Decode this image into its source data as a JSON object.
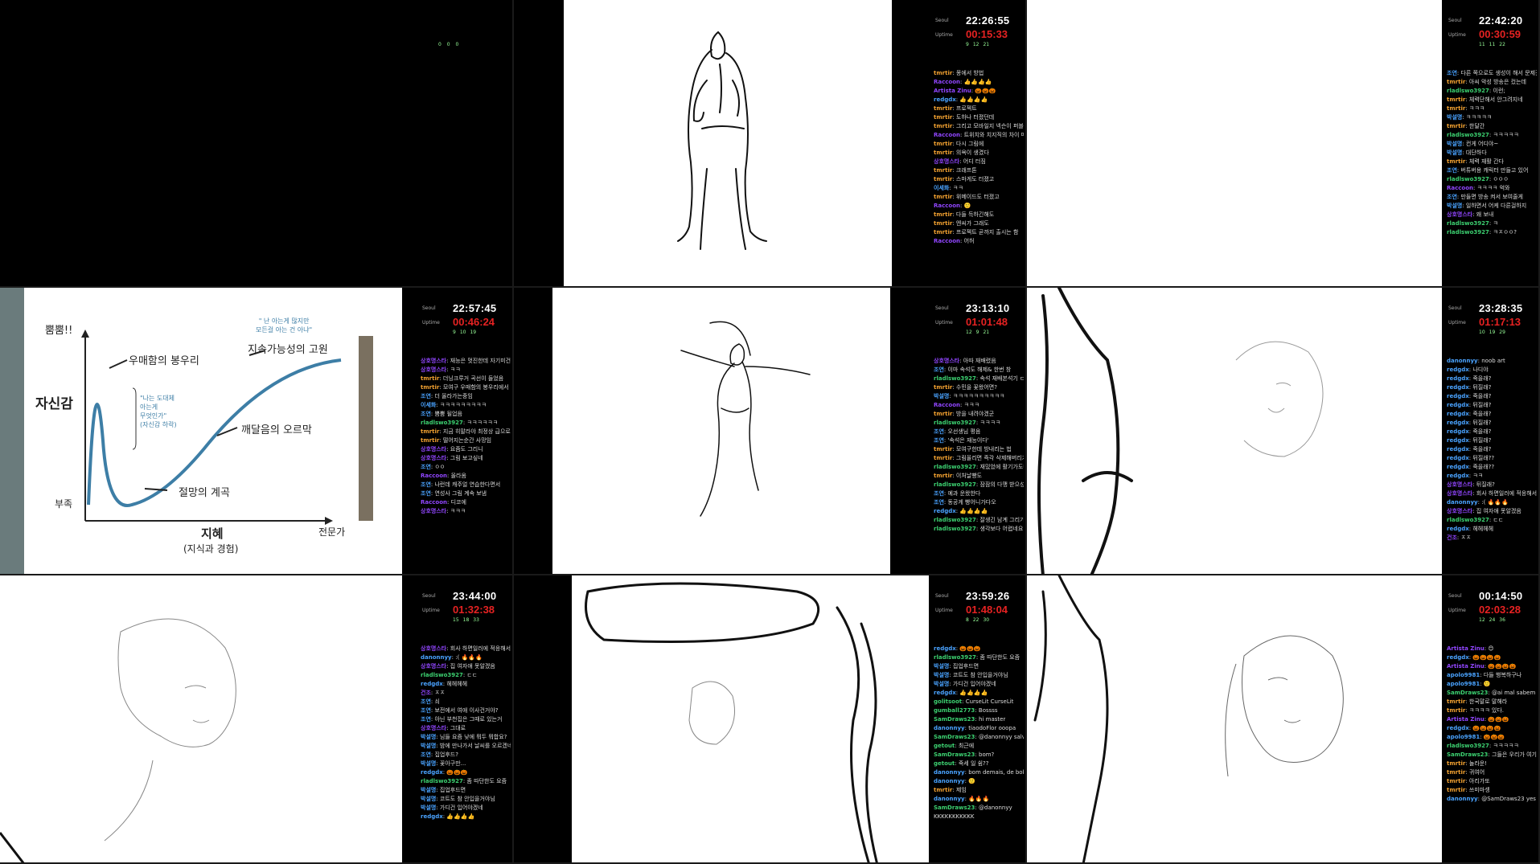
{
  "cells": [
    {
      "stats": {
        "a": "0",
        "b": "0",
        "c": "0"
      }
    },
    {
      "clock_label": "Seoul",
      "uptime_label": "Uptime",
      "time": "22:26:55",
      "uptime": "00:15:33",
      "stats": {
        "a": "9",
        "b": "12",
        "c": "21"
      },
      "chat": [
        {
          "user": "tmrtir",
          "color": "#f0a030",
          "text": "몽에서 방법"
        },
        {
          "user": "Raccoon",
          "color": "#9146ff",
          "text": "👍👍👍👍"
        },
        {
          "user": "Artista Zinu",
          "color": "#9146ff",
          "text": "🎃🎃🎃"
        },
        {
          "user": "redgdx",
          "color": "#4aa3ff",
          "text": "👍👍👍👍"
        },
        {
          "user": "tmrtir",
          "color": "#f0a030",
          "text": "프로젝트"
        },
        {
          "user": "tmrtir",
          "color": "#f0a030",
          "text": "도하나 터졌던데"
        },
        {
          "user": "tmrtir",
          "color": "#f0a030",
          "text": "그리고 모바일지 넥슨이 퍼블리싱한다매"
        },
        {
          "user": "Raccoon",
          "color": "#9146ff",
          "text": "트위치와 치지직의 차이 매출"
        },
        {
          "user": "tmrtir",
          "color": "#f0a030",
          "text": "다시 그림에"
        },
        {
          "user": "tmrtir",
          "color": "#f0a030",
          "text": "의욕이 생겼다"
        },
        {
          "user": "상호명스타",
          "color": "#9146ff",
          "text": "어디 터짐"
        },
        {
          "user": "tmrtir",
          "color": "#f0a030",
          "text": "크래프톤"
        },
        {
          "user": "tmrtir",
          "color": "#f0a030",
          "text": "스마게도 터졌고"
        },
        {
          "user": "이세화",
          "color": "#4aa3ff",
          "text": "ㅋㅋ"
        },
        {
          "user": "tmrtir",
          "color": "#f0a030",
          "text": "위메이드도 터졌고"
        },
        {
          "user": "Raccoon",
          "color": "#9146ff",
          "text": "🙂"
        },
        {
          "user": "tmrtir",
          "color": "#f0a030",
          "text": "다들 득하긴해도"
        },
        {
          "user": "tmrtir",
          "color": "#f0a030",
          "text": "엔씨가 그래도"
        },
        {
          "user": "tmrtir",
          "color": "#f0a030",
          "text": "프로젝트 곧까지 출시는 함"
        },
        {
          "user": "Raccoon",
          "color": "#9146ff",
          "text": "어허"
        }
      ]
    },
    {
      "clock_label": "Seoul",
      "uptime_label": "Uptime",
      "time": "22:42:20",
      "uptime": "00:30:59",
      "stats": {
        "a": "11",
        "b": "11",
        "c": "22"
      },
      "chat": [
        {
          "user": "조연",
          "color": "#4aa3ff",
          "text": "다른 쪽으로도 생성이 해서 문제겠음"
        },
        {
          "user": "tmrtir",
          "color": "#f0a030",
          "text": "아씨 악성 방송은 컸는데"
        },
        {
          "user": "rladlswo3927",
          "color": "#3cd070",
          "text": "이런;"
        },
        {
          "user": "tmrtir",
          "color": "#f0a030",
          "text": "체력단해서 안그려지네"
        },
        {
          "user": "tmrtir",
          "color": "#f0a030",
          "text": "ㅋㅋㅋ"
        },
        {
          "user": "박설명",
          "color": "#4aa3ff",
          "text": "ㅋㅋㅋㅋㅋ"
        },
        {
          "user": "tmrtir",
          "color": "#f0a030",
          "text": "한달간"
        },
        {
          "user": "rladlswo3927",
          "color": "#3cd070",
          "text": "ㅋㅋㅋㅋㅋ"
        },
        {
          "user": "박설명",
          "color": "#4aa3ff",
          "text": "컨게 어디야~"
        },
        {
          "user": "박설명",
          "color": "#4aa3ff",
          "text": "대단하다"
        },
        {
          "user": "tmrtir",
          "color": "#f0a030",
          "text": "체력 재활 간다"
        },
        {
          "user": "조연",
          "color": "#4aa3ff",
          "text": "버튜버용 캐릭터 만들고 있어"
        },
        {
          "user": "rladlswo3927",
          "color": "#3cd070",
          "text": "ㅇㅇㅇ"
        },
        {
          "user": "Raccoon",
          "color": "#9146ff",
          "text": "ㅋㅋㅋㅋ 억와"
        },
        {
          "user": "조연",
          "color": "#4aa3ff",
          "text": "만들면 방송 켜서 보여줄게"
        },
        {
          "user": "박설명",
          "color": "#4aa3ff",
          "text": "일하면서 어케 다른걸하지"
        },
        {
          "user": "상호명스타",
          "color": "#9146ff",
          "text": "왜 보내"
        },
        {
          "user": "rladlswo3927",
          "color": "#3cd070",
          "text": "ㅋ"
        },
        {
          "user": "rladlswo3927",
          "color": "#3cd070",
          "text": "ㅋㅈㅇㅇ?"
        }
      ]
    },
    {
      "clock_label": "Seoul",
      "uptime_label": "Uptime",
      "time": "22:57:45",
      "uptime": "00:46:24",
      "stats": {
        "a": "9",
        "b": "10",
        "c": "19"
      },
      "slide": {
        "ylabel_top": "뿜뿜!!",
        "ylabel": "자신감",
        "ylabel_bottom": "부족",
        "xlabel": "지혜",
        "xlabel_sub": "(지식과 경험)",
        "xlabel_right": "전문가",
        "peak": "우매함의 봉우리",
        "valley": "절망의 계곡",
        "slope": "깨달음의 오르막",
        "plateau": "지속가능성의 고원",
        "quote_top": "\" 난 아는게 많지만\n모든걸 아는 건 아냐\"",
        "quote_mid": "\"나는 도대체\n아는게\n무엇인가\"\n(자신감 하락)"
      },
      "chat": [
        {
          "user": "상호명스타",
          "color": "#9146ff",
          "text": "재능은 멋진한데 자기미건 주입하려고 안될니서 문제임"
        },
        {
          "user": "상호명스타",
          "color": "#9146ff",
          "text": "ㅋㅋ"
        },
        {
          "user": "tmrtir",
          "color": "#f0a030",
          "text": "더닝크루거 곡선이 들었음"
        },
        {
          "user": "tmrtir",
          "color": "#f0a030",
          "text": "모여구 우매함의 봉우리에서 안내려옴"
        },
        {
          "user": "조연",
          "color": "#4aa3ff",
          "text": "더 올라가는중임"
        },
        {
          "user": "이세화",
          "color": "#4aa3ff",
          "text": "ㅋㅋㅋㅋㅋㅋㅋㅋㅋ"
        },
        {
          "user": "조연",
          "color": "#4aa3ff",
          "text": "뿜뿜 될업음"
        },
        {
          "user": "rladlswo3927",
          "color": "#3cd070",
          "text": "ㅋㅋㅋㅋㅋㅋ"
        },
        {
          "user": "tmrtir",
          "color": "#f0a030",
          "text": "지금 히말라야 최정상 급으로 높아서"
        },
        {
          "user": "tmrtir",
          "color": "#f0a030",
          "text": "떨어지는순간 사망임"
        },
        {
          "user": "상호명스타",
          "color": "#9146ff",
          "text": "요즘도 그리니"
        },
        {
          "user": "상호명스타",
          "color": "#9146ff",
          "text": "그림 보고싶네"
        },
        {
          "user": "조연",
          "color": "#4aa3ff",
          "text": "ㅇㅇ"
        },
        {
          "user": "Raccoon",
          "color": "#9146ff",
          "text": "올라옴"
        },
        {
          "user": "조연",
          "color": "#4aa3ff",
          "text": "나런데 캐주얼 연습한다면서"
        },
        {
          "user": "조연",
          "color": "#4aa3ff",
          "text": "연성사 그림 계속 보냄"
        },
        {
          "user": "Raccoon",
          "color": "#9146ff",
          "text": "디코에"
        },
        {
          "user": "상호명스타",
          "color": "#9146ff",
          "text": "ㅋㅋㅋ"
        }
      ]
    },
    {
      "clock_label": "Seoul",
      "uptime_label": "Uptime",
      "time": "23:13:10",
      "uptime": "01:01:48",
      "stats": {
        "a": "12",
        "b": "9",
        "c": "21"
      },
      "chat": [
        {
          "user": "상호명스타",
          "color": "#9146ff",
          "text": "아따 재배렸음"
        },
        {
          "user": "조연",
          "color": "#4aa3ff",
          "text": "이마 속석도 해제& 한번 창"
        },
        {
          "user": "rladlswo3927",
          "color": "#3cd070",
          "text": "속석 재배본석기 ㄷㄷ"
        },
        {
          "user": "tmrtir",
          "color": "#f0a030",
          "text": "수민을 꽃왔어면?"
        },
        {
          "user": "박설명",
          "color": "#4aa3ff",
          "text": "ㅋㅋㅋㅋㅋㅋㅋㅋㅋㅋ"
        },
        {
          "user": "Raccoon",
          "color": "#9146ff",
          "text": "ㅋㅋㅋ"
        },
        {
          "user": "tmrtir",
          "color": "#f0a030",
          "text": "방을 내려야겠군"
        },
        {
          "user": "rladlswo3927",
          "color": "#3cd070",
          "text": "ㅋㅋㅋㅋ"
        },
        {
          "user": "조연",
          "color": "#4aa3ff",
          "text": "오선생님 평음"
        },
        {
          "user": "조연",
          "color": "#4aa3ff",
          "text": "'속석은 재능이다'"
        },
        {
          "user": "tmrtir",
          "color": "#f0a030",
          "text": "모여구한데 방내리는 법"
        },
        {
          "user": "tmrtir",
          "color": "#f0a030",
          "text": "그림올리면 즉각 삭제해버리기"
        },
        {
          "user": "rladlswo3927",
          "color": "#3cd070",
          "text": "재밌었에 활기가도네"
        },
        {
          "user": "tmrtir",
          "color": "#f0a030",
          "text": "이처날빵도"
        },
        {
          "user": "rladlswo3927",
          "color": "#3cd070",
          "text": "잠잠의 다맹 받으성돈"
        },
        {
          "user": "조연",
          "color": "#4aa3ff",
          "text": "예과 운왔한다"
        },
        {
          "user": "조연",
          "color": "#4aa3ff",
          "text": "동공게 빵어니가다오"
        },
        {
          "user": "redgdx",
          "color": "#4aa3ff",
          "text": "👍👍👍👍"
        },
        {
          "user": "rladlswo3927",
          "color": "#3cd070",
          "text": "잘생긴 남계 그리기가"
        },
        {
          "user": "rladlswo3927",
          "color": "#3cd070",
          "text": "생각보다 어렵네요"
        }
      ]
    },
    {
      "clock_label": "Seoul",
      "uptime_label": "Uptime",
      "time": "23:28:35",
      "uptime": "01:17:13",
      "stats": {
        "a": "10",
        "b": "19",
        "c": "29"
      },
      "chat": [
        {
          "user": "danonnyy",
          "color": "#4aa3ff",
          "text": "noob art"
        },
        {
          "user": "redgdx",
          "color": "#4aa3ff",
          "text": "나디야"
        },
        {
          "user": "redgdx",
          "color": "#4aa3ff",
          "text": "죽을래?"
        },
        {
          "user": "redgdx",
          "color": "#4aa3ff",
          "text": "뒤질래?"
        },
        {
          "user": "redgdx",
          "color": "#4aa3ff",
          "text": "죽을래?"
        },
        {
          "user": "redgdx",
          "color": "#4aa3ff",
          "text": "뒤질래?"
        },
        {
          "user": "redgdx",
          "color": "#4aa3ff",
          "text": "죽을래?"
        },
        {
          "user": "redgdx",
          "color": "#4aa3ff",
          "text": "뒤질래?"
        },
        {
          "user": "redgdx",
          "color": "#4aa3ff",
          "text": "죽을래?"
        },
        {
          "user": "redgdx",
          "color": "#4aa3ff",
          "text": "뒤질래?"
        },
        {
          "user": "redgdx",
          "color": "#4aa3ff",
          "text": "죽을래?"
        },
        {
          "user": "redgdx",
          "color": "#4aa3ff",
          "text": "뒤질래??"
        },
        {
          "user": "redgdx",
          "color": "#4aa3ff",
          "text": "죽을래??"
        },
        {
          "user": "redgdx",
          "color": "#4aa3ff",
          "text": "ㅋㅋ"
        },
        {
          "user": "상호명스타",
          "color": "#9146ff",
          "text": "뒤질래?"
        },
        {
          "user": "상호명스타",
          "color": "#9146ff",
          "text": "회사 하면일러에 적응해서"
        },
        {
          "user": "danonnyy",
          "color": "#4aa3ff",
          "text": ":( 🔥🔥🔥"
        },
        {
          "user": "상호명스타",
          "color": "#9146ff",
          "text": "집 여자애 못알겠음"
        },
        {
          "user": "rladlswo3927",
          "color": "#3cd070",
          "text": "ㄷㄷ"
        },
        {
          "user": "redgdx",
          "color": "#4aa3ff",
          "text": "헤헤헤헤"
        },
        {
          "user": "건조",
          "color": "#9146ff",
          "text": "ㅈㅈ"
        }
      ]
    },
    {
      "clock_label": "Seoul",
      "uptime_label": "Uptime",
      "time": "23:44:00",
      "uptime": "01:32:38",
      "stats": {
        "a": "15",
        "b": "18",
        "c": "33"
      },
      "chat": [
        {
          "user": "상호명스타",
          "color": "#9146ff",
          "text": "회사 하면일러에 적응해서"
        },
        {
          "user": "danonnyy",
          "color": "#4aa3ff",
          "text": ":( 🔥🔥🔥"
        },
        {
          "user": "상호명스타",
          "color": "#9146ff",
          "text": "집 여자애 못알겠음"
        },
        {
          "user": "rladlswo3927",
          "color": "#3cd070",
          "text": "ㄷㄷ"
        },
        {
          "user": "redgdx",
          "color": "#4aa3ff",
          "text": "헤헤헤헤"
        },
        {
          "user": "건조",
          "color": "#9146ff",
          "text": "ㅈㅈ"
        },
        {
          "user": "조연",
          "color": "#4aa3ff",
          "text": "쇠"
        },
        {
          "user": "조연",
          "color": "#4aa3ff",
          "text": "보전에서 여애 이사건거야?"
        },
        {
          "user": "조연",
          "color": "#4aa3ff",
          "text": "아닌 부천집은 그때로 있는거"
        },
        {
          "user": "상호명스타",
          "color": "#9146ff",
          "text": "그대로"
        },
        {
          "user": "박설명",
          "color": "#4aa3ff",
          "text": "님들 요즘 낮에 뭐두 뭐합요?"
        },
        {
          "user": "박설명",
          "color": "#4aa3ff",
          "text": "밤에 만나가서 날씨를 오르겠네"
        },
        {
          "user": "조연",
          "color": "#4aa3ff",
          "text": "집업후드?"
        },
        {
          "user": "박설명",
          "color": "#4aa3ff",
          "text": "꽃아구만..."
        },
        {
          "user": "redgdx",
          "color": "#4aa3ff",
          "text": "🎃🎃🎃"
        },
        {
          "user": "rladlswo3927",
          "color": "#3cd070",
          "text": "좀 따단한도 요즘"
        },
        {
          "user": "박설명",
          "color": "#4aa3ff",
          "text": "집업후드면"
        },
        {
          "user": "박설명",
          "color": "#4aa3ff",
          "text": "코트도 참 안입을거야님"
        },
        {
          "user": "박설명",
          "color": "#4aa3ff",
          "text": "가디건 입어야겠네"
        },
        {
          "user": "redgdx",
          "color": "#4aa3ff",
          "text": "👍👍👍👍"
        }
      ]
    },
    {
      "clock_label": "Seoul",
      "uptime_label": "Uptime",
      "time": "23:59:26",
      "uptime": "01:48:04",
      "stats": {
        "a": "8",
        "b": "22",
        "c": "30"
      },
      "chat": [
        {
          "user": "redgdx",
          "color": "#4aa3ff",
          "text": "🎃🎃🎃"
        },
        {
          "user": "rladlswo3927",
          "color": "#3cd070",
          "text": "좀 따단한도 요즘"
        },
        {
          "user": "박설명",
          "color": "#4aa3ff",
          "text": "집업후드면"
        },
        {
          "user": "박설명",
          "color": "#4aa3ff",
          "text": "코트도 참 안입을거야님"
        },
        {
          "user": "박설명",
          "color": "#4aa3ff",
          "text": "가디건 입어야겠네"
        },
        {
          "user": "redgdx",
          "color": "#4aa3ff",
          "text": "👍👍👍👍"
        },
        {
          "user": "golitsoot",
          "color": "#3cd070",
          "text": "CurseLit CurseLit"
        },
        {
          "user": "gumball2773",
          "color": "#3cd070",
          "text": "Bossss"
        },
        {
          "user": "SamDraws23",
          "color": "#3cd070",
          "text": "hi master"
        },
        {
          "user": "danonnyy",
          "color": "#4aa3ff",
          "text": "tiaodoFlor ooopa"
        },
        {
          "user": "SamDraws23",
          "color": "#3cd070",
          "text": "@danonnyy salve"
        },
        {
          "user": "getout",
          "color": "#3cd070",
          "text": "최근에"
        },
        {
          "user": "SamDraws23",
          "color": "#3cd070",
          "text": "bom?"
        },
        {
          "user": "getout",
          "color": "#3cd070",
          "text": "죽세 일 쉼??"
        },
        {
          "user": "danonnyy",
          "color": "#4aa3ff",
          "text": "bom demais, de bobeira, vendo essa transmissão ruim e arte péssima."
        },
        {
          "user": "danonnyy",
          "color": "#4aa3ff",
          "text": "🙂"
        },
        {
          "user": "tmrtir",
          "color": "#f0a030",
          "text": "제임"
        },
        {
          "user": "danonnyy",
          "color": "#4aa3ff",
          "text": "🔥🔥🔥"
        },
        {
          "user": "SamDraws23",
          "color": "#3cd070",
          "text": "@danonnyy"
        },
        {
          "user": "",
          "color": "#fff",
          "text": "KKKKKKKKKKK"
        }
      ]
    },
    {
      "clock_label": "Seoul",
      "uptime_label": "Uptime",
      "time": "00:14:50",
      "uptime": "02:03:28",
      "stats": {
        "a": "12",
        "b": "24",
        "c": "36"
      },
      "chat": [
        {
          "user": "Artista Zinu",
          "color": "#9146ff",
          "text": "😊"
        },
        {
          "user": "redgdx",
          "color": "#4aa3ff",
          "text": "🎃🎃🎃🎃"
        },
        {
          "user": "Artista Zinu",
          "color": "#9146ff",
          "text": "🎃🎃🎃🎃"
        },
        {
          "user": "apolo9981",
          "color": "#4aa3ff",
          "text": "다들 행복하구나"
        },
        {
          "user": "apolo9981",
          "color": "#4aa3ff",
          "text": "🙂"
        },
        {
          "user": "SamDraws23",
          "color": "#3cd070",
          "text": "@ai mal sabem eles que estamos aqui a anos e adoramos o tmrtir LUL"
        },
        {
          "user": "tmrtir",
          "color": "#f0a030",
          "text": "한국말로 말해라"
        },
        {
          "user": "tmrtir",
          "color": "#f0a030",
          "text": "ㅋㅋㅋㅋ 있다."
        },
        {
          "user": "Artista Zinu",
          "color": "#9146ff",
          "text": "🎃🎃🎃"
        },
        {
          "user": "redgdx",
          "color": "#4aa3ff",
          "text": "🎃🎃🎃🎃"
        },
        {
          "user": "apolo9981",
          "color": "#4aa3ff",
          "text": "🎃🎃🎃"
        },
        {
          "user": "rladlswo3927",
          "color": "#3cd070",
          "text": "ㅋㅋㅋㅋㅋ"
        },
        {
          "user": "SamDraws23",
          "color": "#3cd070",
          "text": "그들은 우리가 여기 몇 년 동안 살았고 🎃 정말 좋아한다는 사실을 전혀 몰라요. LUL"
        },
        {
          "user": "tmrtir",
          "color": "#f0a030",
          "text": "놀라운!"
        },
        {
          "user": "tmrtir",
          "color": "#f0a030",
          "text": "귀여어"
        },
        {
          "user": "tmrtir",
          "color": "#f0a030",
          "text": "아리가또"
        },
        {
          "user": "tmrtir",
          "color": "#f0a030",
          "text": "쓰미마셍"
        },
        {
          "user": "danonnyy",
          "color": "#4aa3ff",
          "text": "@SamDraws23 yes"
        }
      ]
    }
  ]
}
